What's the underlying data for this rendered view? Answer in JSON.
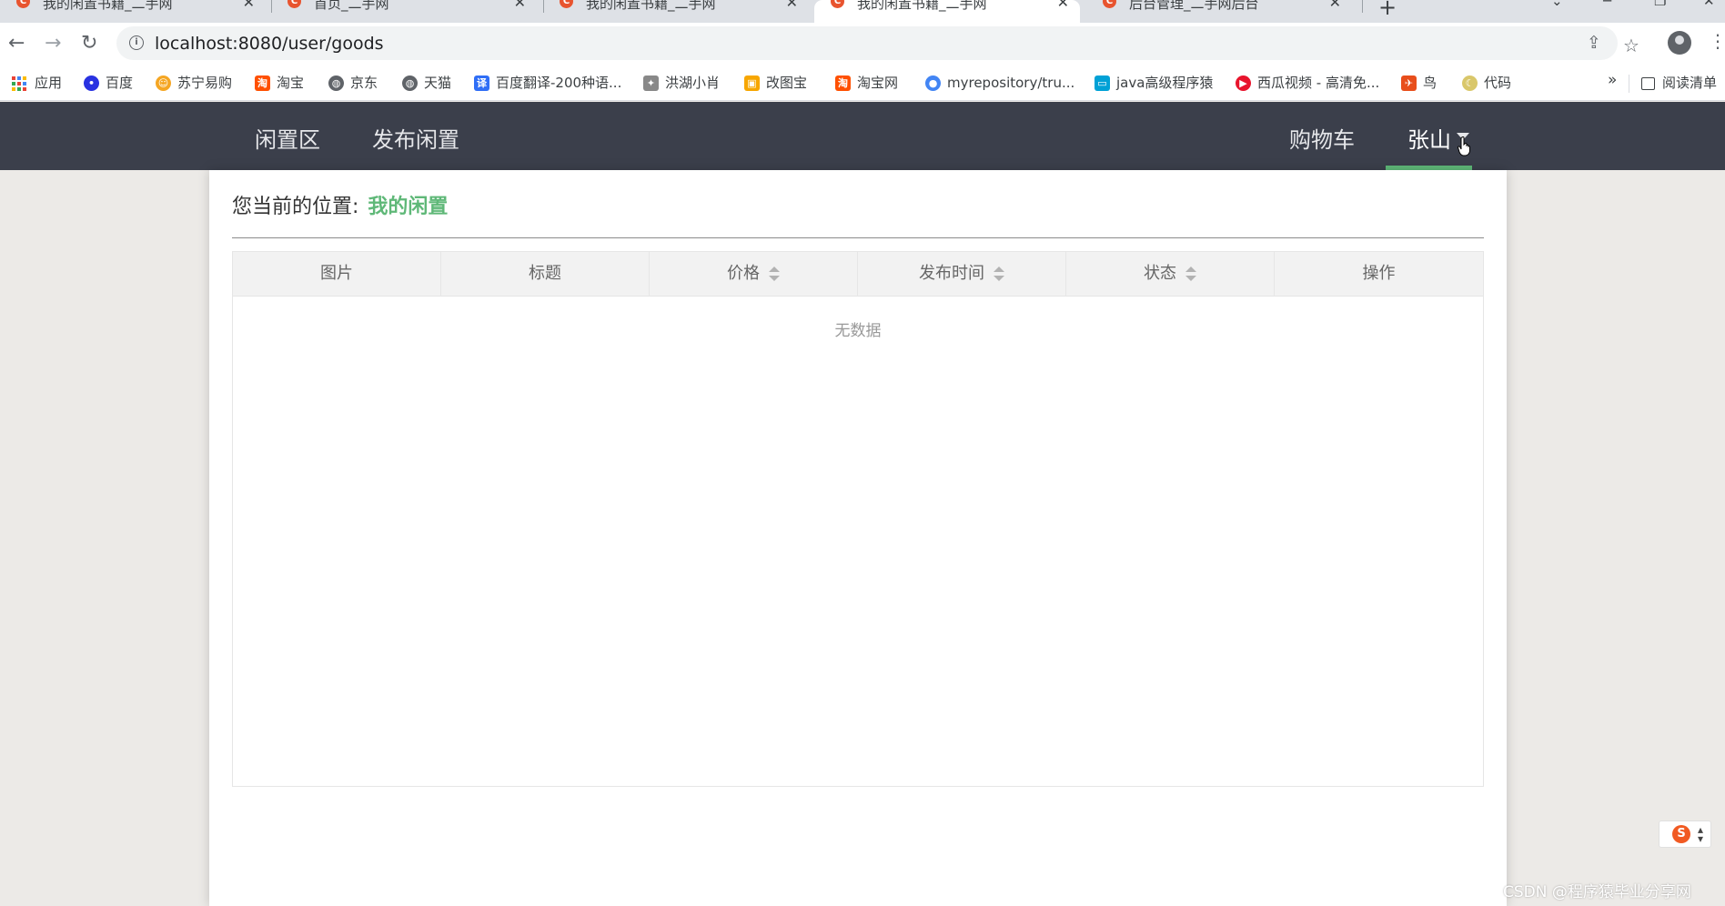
{
  "browser": {
    "tabs": [
      {
        "title": "我的闲置书籍_二手网",
        "active": false
      },
      {
        "title": "首页_二手网",
        "active": false
      },
      {
        "title": "我的闲置书籍_二手网",
        "active": false
      },
      {
        "title": "我的闲置书籍_二手网",
        "active": true
      },
      {
        "title": "后台管理_二手网后台",
        "active": false
      }
    ],
    "address": "localhost:8080/user/goods",
    "bookmarks": [
      {
        "label": "应用",
        "icon": "apps-grid-icon"
      },
      {
        "label": "百度",
        "icon": "baidu-paw-icon",
        "color": "#2932e1"
      },
      {
        "label": "苏宁易购",
        "icon": "suning-lion-icon",
        "color": "#f5a623"
      },
      {
        "label": "淘宝",
        "icon": "taobao-icon",
        "color": "#ff5000"
      },
      {
        "label": "京东",
        "icon": "globe-icon",
        "color": "#5f6368"
      },
      {
        "label": "天猫",
        "icon": "globe-icon",
        "color": "#5f6368"
      },
      {
        "label": "百度翻译-200种语...",
        "icon": "translate-icon",
        "color": "#2f6ef6"
      },
      {
        "label": "洪湖小肖",
        "icon": "bird-icon",
        "color": "#888888"
      },
      {
        "label": "改图宝",
        "icon": "image-edit-icon",
        "color": "#f7a600"
      },
      {
        "label": "淘宝网",
        "icon": "taobao-icon",
        "color": "#ff5000"
      },
      {
        "label": "myrepository/tru...",
        "icon": "chrome-icon",
        "color": "#4285f4"
      },
      {
        "label": "java高级程序猿",
        "icon": "bilibili-tv-icon",
        "color": "#00a1d6"
      },
      {
        "label": "西瓜视频 - 高清免...",
        "icon": "xigua-play-icon",
        "color": "#e8142c"
      },
      {
        "label": "鸟",
        "icon": "bird-icon",
        "color": "#e84e1b"
      },
      {
        "label": "代码",
        "icon": "moon-icon",
        "color": "#d9c76a"
      }
    ],
    "reading_list": "阅读清单"
  },
  "header": {
    "nav": [
      "闲置区",
      "发布闲置"
    ],
    "cart": "购物车",
    "user": "张山"
  },
  "breadcrumb": {
    "prefix": "您当前的位置:",
    "current": "我的闲置"
  },
  "table": {
    "columns": [
      {
        "label": "图片",
        "sortable": false
      },
      {
        "label": "标题",
        "sortable": false
      },
      {
        "label": "价格",
        "sortable": true
      },
      {
        "label": "发布时间",
        "sortable": true
      },
      {
        "label": "状态",
        "sortable": true
      },
      {
        "label": "操作",
        "sortable": false
      }
    ],
    "empty_text": "无数据"
  },
  "watermark": "CSDN @程序猿毕业分享网",
  "colors": {
    "header_bg": "#3b3f4b",
    "accent": "#5fb878"
  }
}
